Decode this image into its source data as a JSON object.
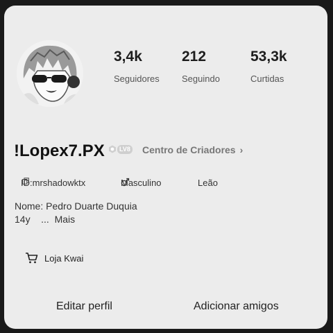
{
  "profile": {
    "username": "!Lopex7.PX",
    "level_badge": "LV8",
    "creator_center": "Centro de Criadores",
    "id_label": "ID:mrshadowktx",
    "gender": "Masculino",
    "sign": "Leão",
    "bio_line1": "Nome: Pedro Duarte Duquia",
    "bio_age": "14y",
    "bio_more": "...  Mais",
    "shop": "Loja Kwai"
  },
  "stats": [
    {
      "value": "3,4k",
      "label": "Seguidores"
    },
    {
      "value": "212",
      "label": "Seguindo"
    },
    {
      "value": "53,3k",
      "label": "Curtidas"
    }
  ],
  "actions": {
    "edit_profile": "Editar perfil",
    "add_friends": "Adicionar amigos"
  },
  "icons": {
    "copy": "copy-icon",
    "male": "male-gender-icon",
    "chevron": "chevron-right-icon",
    "cart": "cart-icon"
  }
}
